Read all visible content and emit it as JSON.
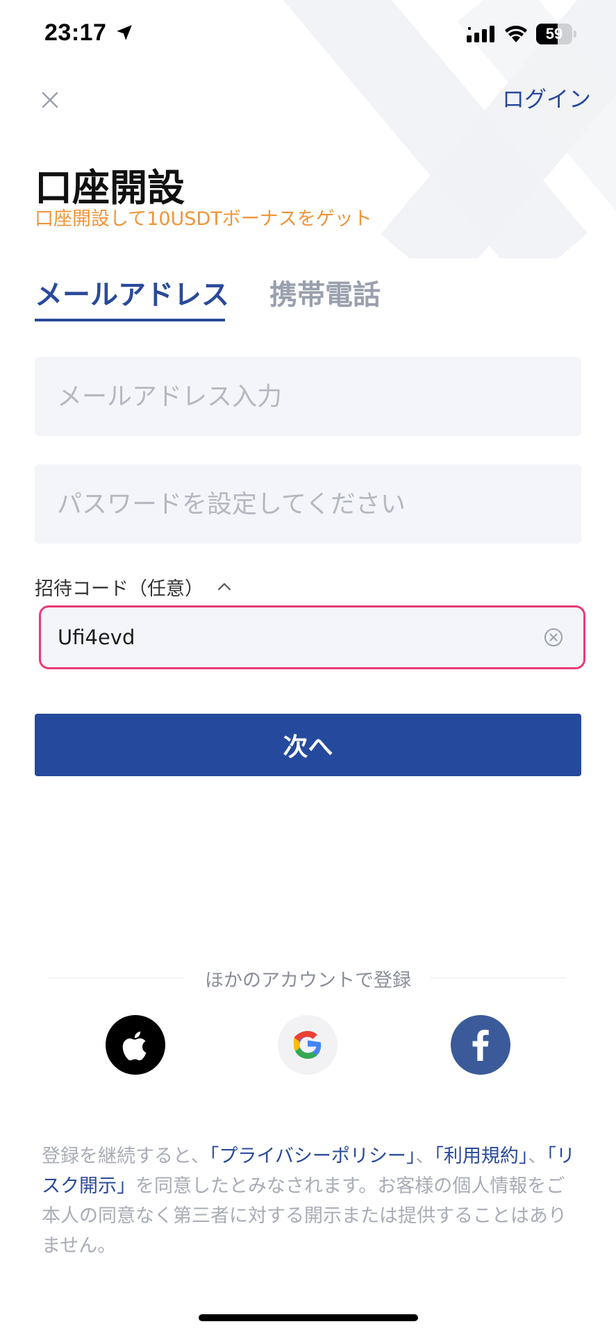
{
  "status_bar": {
    "time": "23:17",
    "battery_level": "59",
    "battery_fraction": 0.59,
    "icons": [
      "location-arrow-icon",
      "signal-icon",
      "wifi-icon",
      "battery-icon"
    ]
  },
  "header": {
    "close_icon": "close-icon",
    "login_label": "ログイン",
    "title": "口座開設",
    "subtitle": "口座開設して10USDTボーナスをゲット"
  },
  "tabs": [
    {
      "label": "メールアドレス",
      "active": true
    },
    {
      "label": "携帯電話",
      "active": false
    }
  ],
  "form": {
    "email_placeholder": "メールアドレス入力",
    "email_value": "",
    "password_placeholder": "パスワードを設定してください",
    "password_value": "",
    "invite_label": "招待コード（任意）",
    "invite_toggle_icon": "chevron-up-icon",
    "invite_value": "Ufi4evd",
    "clear_icon": "clear-circle-icon",
    "next_label": "次へ"
  },
  "social": {
    "label": "ほかのアカウントで登録",
    "providers": [
      {
        "name": "Apple",
        "icon": "apple-icon"
      },
      {
        "name": "Google",
        "icon": "google-icon"
      },
      {
        "name": "Facebook",
        "icon": "facebook-icon"
      }
    ]
  },
  "legal": {
    "prefix": "登録を継続すると、",
    "privacy_link": "「プライバシーポリシー」",
    "separator1": "、",
    "terms_link": "「利用規約」",
    "separator2": "、",
    "risk_link": "「リスク開示」",
    "suffix": "を同意したとみなされます。お客様の個人情報をご本人の同意なく第三者に対する開示または提供することはありません。"
  },
  "colors": {
    "brand_blue": "#254a9d",
    "link_blue": "#2a4a9a",
    "accent_orange": "#f0943a",
    "highlight_pink": "#e93a74",
    "input_bg": "#f4f5fa",
    "muted_text": "#a8acb6"
  }
}
